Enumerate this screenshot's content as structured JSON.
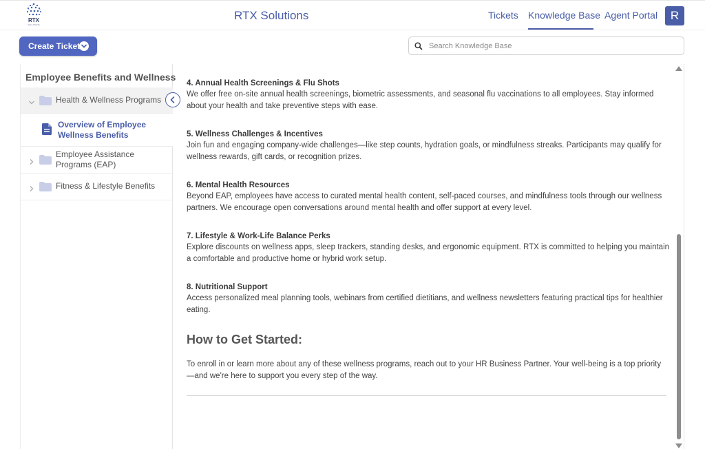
{
  "header": {
    "logo_text": "RTX",
    "logo_tagline": "SOLUTIONS",
    "app_title": "RTX Solutions",
    "nav": {
      "tickets": "Tickets",
      "knowledge_base": "Knowledge Base",
      "agent_portal": "Agent Portal"
    },
    "active_nav": "Knowledge Base",
    "avatar_initial": "R",
    "accent_color": "#4a5ea8"
  },
  "toolbar": {
    "create_ticket_label": "Create Ticket",
    "search_placeholder": "Search Knowledge Base",
    "search_value": ""
  },
  "sidebar": {
    "title": "Employee Benefits and Wellness",
    "items": [
      {
        "label": "Health & Wellness Programs",
        "icon": "folder-icon",
        "state": "expanded"
      },
      {
        "label": "Overview of Employee Wellness Benefits",
        "icon": "document-icon",
        "state": "selected"
      },
      {
        "label": "Employee Assistance Programs (EAP)",
        "icon": "folder-icon",
        "state": "collapsed"
      },
      {
        "label": "Fitness & Lifestyle Benefits",
        "icon": "folder-icon",
        "state": "collapsed"
      }
    ]
  },
  "article": {
    "sections": [
      {
        "heading": "4. Annual Health Screenings & Flu Shots",
        "body": "We offer free on-site annual health screenings, biometric assessments, and seasonal flu vaccinations to all employees. Stay informed about your health and take preventive steps with ease."
      },
      {
        "heading": "5. Wellness Challenges & Incentives",
        "body": "Join fun and engaging company-wide challenges—like step counts, hydration goals, or mindfulness streaks. Participants may qualify for wellness rewards, gift cards, or recognition prizes."
      },
      {
        "heading": "6. Mental Health Resources",
        "body": "Beyond EAP, employees have access to curated mental health content, self-paced courses, and mindfulness tools through our wellness partners. We encourage open conversations around mental health and offer support at every level."
      },
      {
        "heading": "7. Lifestyle & Work-Life Balance Perks",
        "body": "Explore discounts on wellness apps, sleep trackers, standing desks, and ergonomic equipment. RTX is committed to helping you maintain a comfortable and productive home or hybrid work setup."
      },
      {
        "heading": "8. Nutritional Support",
        "body": "Access personalized meal planning tools, webinars from certified dietitians, and wellness newsletters featuring practical tips for healthier eating."
      }
    ],
    "how_title": "How to Get Started:",
    "how_text": "To enroll in or learn more about any of these wellness programs, reach out to your HR Business Partner. Your well-being is a top priority—and we're here to support you every step of the way."
  }
}
